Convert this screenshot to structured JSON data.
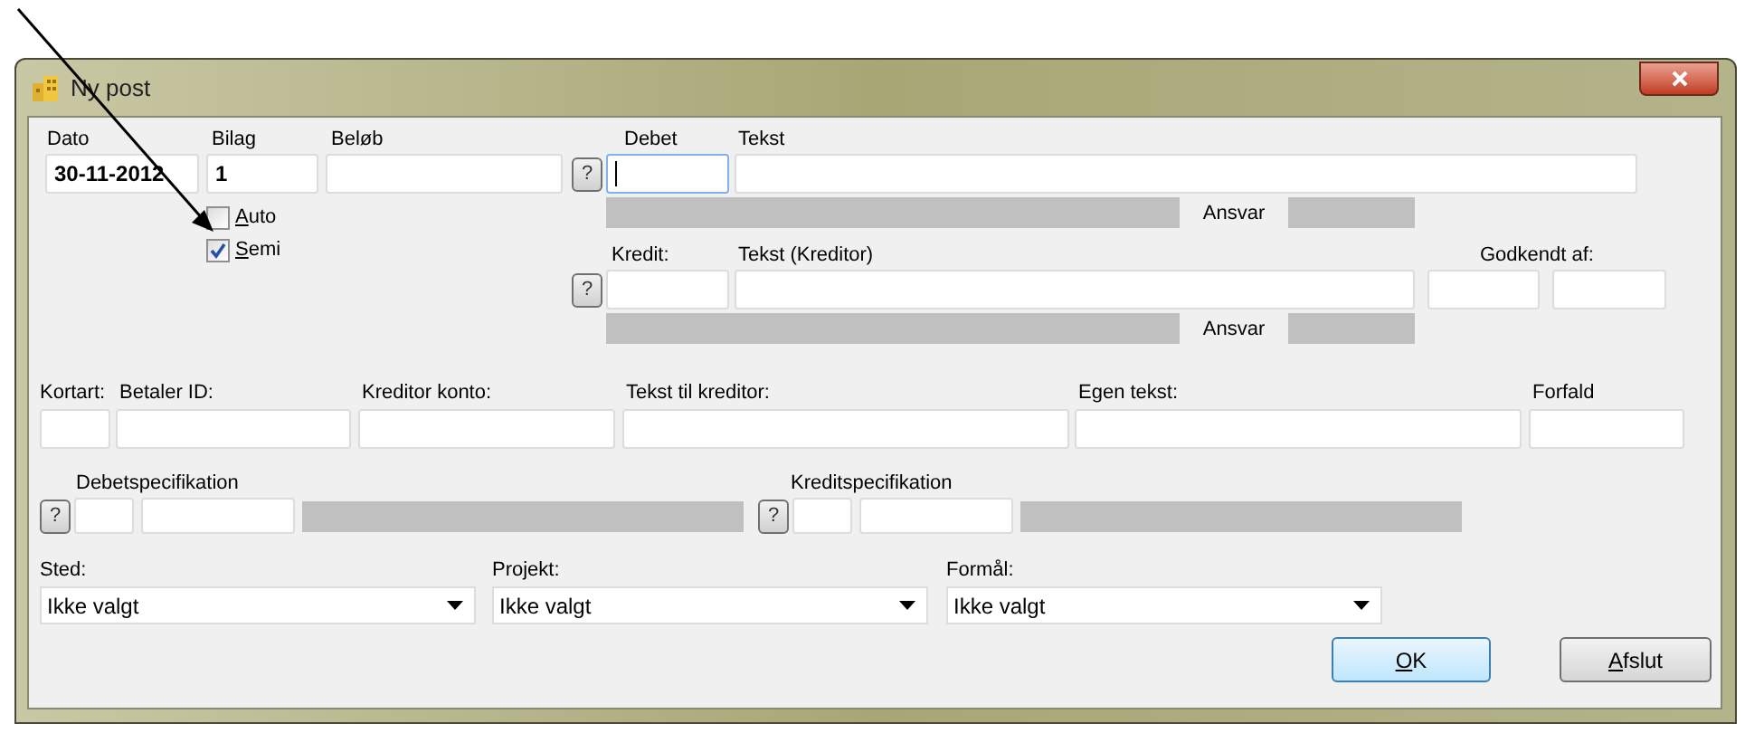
{
  "window": {
    "title": "Ny post"
  },
  "header_fields": [
    {
      "label": "Dato",
      "value": "30-11-2012"
    },
    {
      "label": "Bilag",
      "value": "1"
    },
    {
      "label": "Beløb"
    }
  ],
  "checkboxes": [
    {
      "label": "Auto",
      "checked": false
    },
    {
      "label": "Semi",
      "checked": true
    }
  ],
  "debet": {
    "help_button": "?",
    "label": "Debet",
    "text_label": "Tekst",
    "focused": true,
    "ansvar_label": "Ansvar"
  },
  "kredit": {
    "help_button": "?",
    "label": "Kredit:",
    "text_label": "Tekst (Kreditor)",
    "focused": false,
    "ansvar_label": "Ansvar"
  },
  "approved_by": {
    "label": "Godkendt af:"
  },
  "payment_fields": [
    {
      "label": "Kortart:"
    },
    {
      "label": "Betaler ID:"
    },
    {
      "label": "Kreditor konto:"
    },
    {
      "label": "Tekst til kreditor:"
    },
    {
      "label": "Egen tekst:"
    },
    {
      "label": "Forfald"
    }
  ],
  "specifications": [
    {
      "label": "Debetspecifikation",
      "help_button": "?"
    },
    {
      "label": "Kreditspecifikation",
      "help_button": "?"
    }
  ],
  "dropdowns": [
    {
      "label": "Sted:",
      "value": "Ikke valgt"
    },
    {
      "label": "Projekt:",
      "value": "Ikke valgt"
    },
    {
      "label": "Formål:",
      "value": "Ikke valgt"
    }
  ],
  "buttons": [
    {
      "label": "OK",
      "default": true
    },
    {
      "label": "Afslut",
      "default": false
    }
  ]
}
